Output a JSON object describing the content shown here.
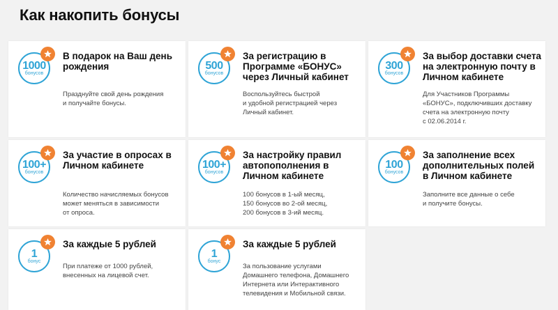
{
  "title": "Как накопить бонусы",
  "colors": {
    "accent_blue": "#2fa4d6",
    "star_orange": "#f08232"
  },
  "cards": [
    {
      "badge_value": "1000",
      "badge_unit": "бонусов",
      "title": "В подарок на Ваш день рождения",
      "desc": [
        "Празднуйте свой день рождения",
        "и получайте бонусы."
      ]
    },
    {
      "badge_value": "500",
      "badge_unit": "бонусов",
      "title": "За регистрацию в Программе «БОНУС» через Личный кабинет",
      "desc": [
        "Воспользуйтесь быстрой",
        "и удобной регистрацией через",
        "Личный кабинет."
      ]
    },
    {
      "badge_value": "300",
      "badge_unit": "бонусов",
      "title": "За выбор доставки счета на электронную почту в Личном кабинете",
      "desc": [
        "Для Участников Программы",
        "«БОНУС», подключивших доставку",
        "счета на электронную почту",
        "с 02.06.2014 г."
      ]
    },
    {
      "badge_value": "100+",
      "badge_unit": "бонусов",
      "title": "За участие в опросах в Личном кабинете",
      "desc": [
        "Количество начисляемых бонусов",
        "может меняться в зависимости",
        "от опроса."
      ]
    },
    {
      "badge_value": "100+",
      "badge_unit": "бонусов",
      "title": "За настройку правил автопополнения в Личном кабинете",
      "desc": [
        "100 бонусов в 1-ый месяц,",
        "150 бонусов во 2-ой месяц,",
        "200 бонусов в 3-ий месяц."
      ]
    },
    {
      "badge_value": "100",
      "badge_unit": "бонусов",
      "title": "За заполнение всех дополнительных полей в Личном кабинете",
      "desc": [
        "Заполните все данные о себе",
        "и получите бонусы."
      ]
    },
    {
      "badge_value": "1",
      "badge_unit": "бонус",
      "title": "За каждые 5 рублей",
      "desc": [
        "При платеже от 1000 рублей,",
        "внесенных на лицевой счет."
      ]
    },
    {
      "badge_value": "1",
      "badge_unit": "бонус",
      "title": "За каждые 5 рублей",
      "desc": [
        "За пользование услугами",
        "Домашнего телефона, Домашнего",
        "Интернета или Интерактивного",
        "телевидения и Мобильной связи."
      ]
    }
  ]
}
